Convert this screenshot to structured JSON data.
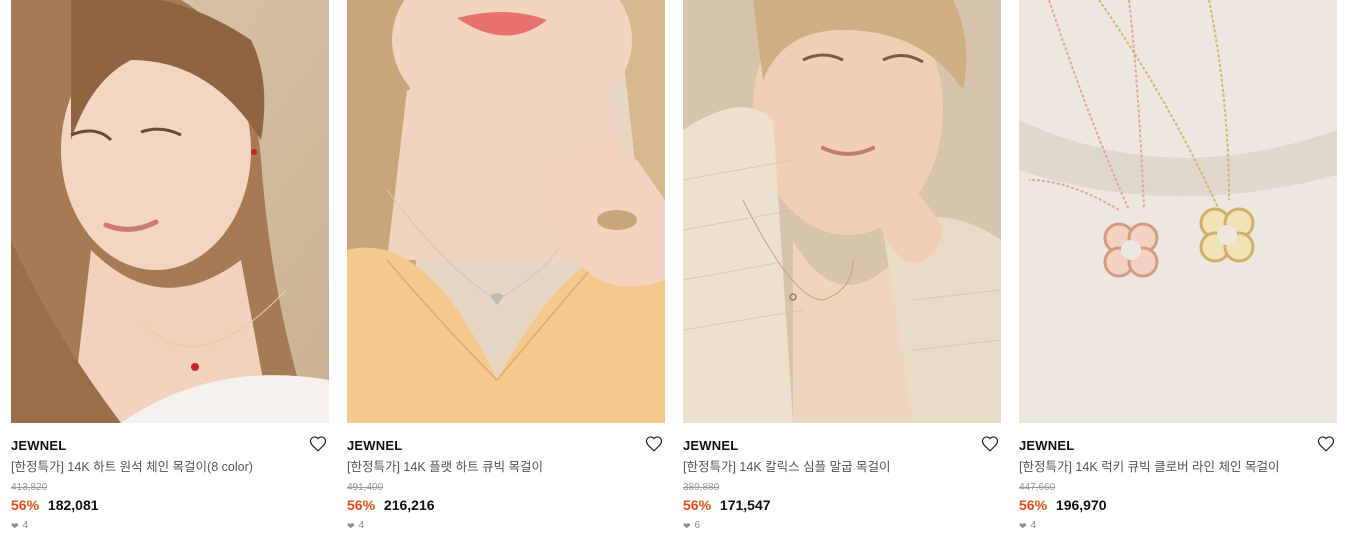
{
  "products": [
    {
      "brand": "JEWNEL",
      "title": "[한정특가] 14K 하트 원석 체인 목걸이(8 color)",
      "original_price": "413,820",
      "discount": "56%",
      "price": "182,081",
      "likes": "4",
      "image_desc": "model-wearing-red-heart-necklace"
    },
    {
      "brand": "JEWNEL",
      "title": "[한정특가] 14K 플랫 하트 큐빅 목걸이",
      "original_price": "491,400",
      "discount": "56%",
      "price": "216,216",
      "likes": "4",
      "image_desc": "model-wearing-flat-heart-necklace"
    },
    {
      "brand": "JEWNEL",
      "title": "[한정특가] 14K 칼릭스 심플 말굽 목걸이",
      "original_price": "389,880",
      "discount": "56%",
      "price": "171,547",
      "likes": "6",
      "image_desc": "model-wearing-horseshoe-necklace"
    },
    {
      "brand": "JEWNEL",
      "title": "[한정특가] 14K 럭키 큐빅 클로버 라인 체인 목걸이",
      "original_price": "447,660",
      "discount": "56%",
      "price": "196,970",
      "likes": "4",
      "image_desc": "clover-pendant-necklaces-product-shot"
    }
  ],
  "colors": {
    "discount": "#f04a18",
    "text": "#111111",
    "muted": "#555555"
  }
}
